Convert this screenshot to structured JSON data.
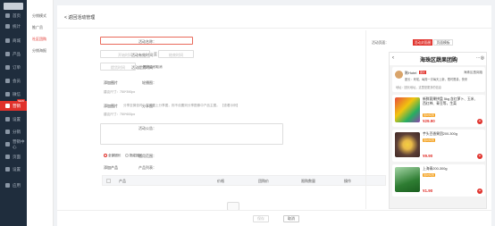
{
  "sidebar": {
    "items": [
      {
        "label": "首页",
        "icon": "home-icon"
      },
      {
        "label": "统计",
        "icon": "stats-icon"
      },
      {
        "label": "商城",
        "icon": "shop-icon"
      },
      {
        "label": "产品",
        "icon": "product-icon"
      },
      {
        "label": "订单",
        "icon": "order-icon"
      },
      {
        "label": "会员",
        "icon": "member-icon"
      },
      {
        "label": "微信",
        "icon": "wechat-icon"
      },
      {
        "label": "营销",
        "icon": "marketing-icon",
        "badge": "NEW"
      },
      {
        "label": "设置",
        "icon": "settings-icon"
      },
      {
        "label": "分销",
        "icon": "distribution-icon"
      },
      {
        "label": "营销中心",
        "icon": "center-icon"
      },
      {
        "label": "页面",
        "icon": "page-icon"
      },
      {
        "label": "设置",
        "icon": "gear-icon"
      },
      {
        "label": "应用",
        "icon": "apps-icon"
      }
    ]
  },
  "submenu": {
    "items": [
      "分销模式",
      "推广员",
      "社区团购",
      "分销海报"
    ]
  },
  "page": {
    "back": "< 返回活动管理"
  },
  "form": {
    "name_label": "活动名称：",
    "time_label": "活动有效时间：",
    "start_placeholder": "开始时间",
    "end_placeholder": "结束时间",
    "to": "至",
    "pickup_label": "活动提货时间：",
    "pickup_placeholder": "提货时间",
    "pickup_hint": "提货后可取消",
    "banner_label": "轮播图：",
    "banner_btn": "添加图片",
    "banner_hint": "建议尺寸：750*390px",
    "share_label": "分享图：",
    "share_btn": "添加图片",
    "share_hint": "分享至微信时，未设置上分享图，则不设置则分享图像中产品主图。 【查看示例】",
    "share_hint2": "建议尺寸：750*600px",
    "notice_label": "活动公告：",
    "scope_label": "适用范围：",
    "scope_all": "全部团长",
    "scope_some": "指定团长",
    "product_label": "产品列表：",
    "product_btn": "添加产品",
    "columns": [
      "产品",
      "价格",
      "团购价",
      "限购数量",
      "操作"
    ]
  },
  "footer": {
    "save": "保存",
    "cancel": "取消"
  },
  "preview": {
    "label": "活动页面：",
    "tab1": "活动封面图",
    "tab2": "页面模板",
    "title": "海珠区蔬果团购",
    "store_name": "陈Hotel",
    "store_badge": "团长",
    "store_addr": "海珠区昌岗路",
    "store_desc": "团长：来啦，每周一次每天上新，限时限量，快来",
    "store_desc2": "地址：团长地址，这里是更多的信息",
    "products": [
      {
        "name": "新鲜蔬果拼盘 5kg 含红萝卜、玉米、西红柿、青豆等，生菜",
        "tag": "限时特惠",
        "price": "¥29.90"
      },
      {
        "name": "芋头百香果团200-300g",
        "tag": "限时特惠",
        "price": "¥9.90"
      },
      {
        "name": "上海青200-300g",
        "tag": "限时特惠",
        "price": "¥1.90"
      }
    ]
  },
  "colors": {
    "accent": "#e0312b",
    "sidebar": "#1f2d3d"
  }
}
